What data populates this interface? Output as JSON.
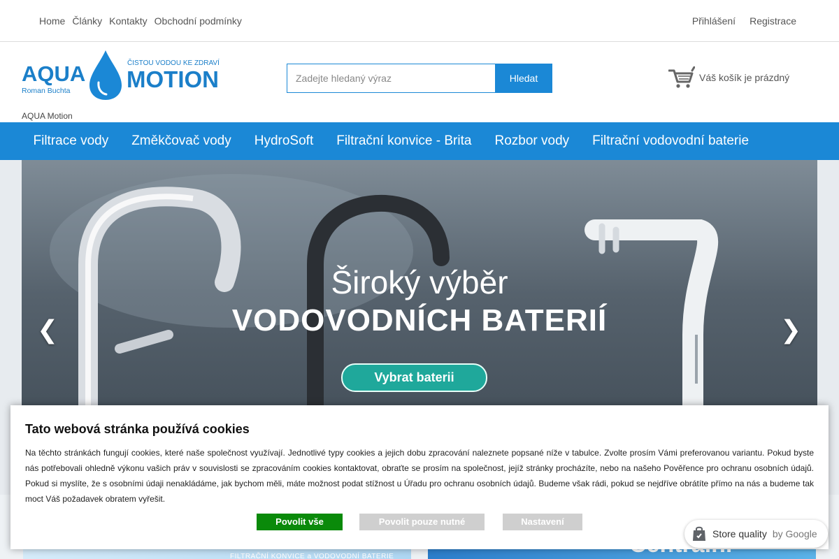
{
  "topnav": {
    "items": [
      "Home",
      "Články",
      "Kontakty",
      "Obchodní podmínky"
    ]
  },
  "account": {
    "login": "Přihlášení",
    "register": "Registrace"
  },
  "logo": {
    "word1": "AQUA",
    "word2": "MOTION",
    "tagline": "ČISTOU VODOU KE ZDRAVÍ",
    "owner": "Roman Buchta",
    "caption": "AQUA Motion"
  },
  "search": {
    "placeholder": "Zadejte hledaný výraz",
    "button": "Hledat"
  },
  "cart": {
    "text": "Váš košík je prázdný"
  },
  "mainnav": {
    "items": [
      "Filtrace vody",
      "Změkčovač vody",
      "HydroSoft",
      "Filtrační konvice - Brita",
      "Rozbor vody",
      "Filtrační vodovodní baterie"
    ]
  },
  "slider": {
    "title1": "Široký výběr",
    "title2": "VODOVODNÍCH BATERIÍ",
    "button": "Vybrat baterii",
    "prev": "❮",
    "next": "❯"
  },
  "promos": {
    "left_text": "FILTRAČNÍ KONVICE a VODOVODNÍ BATERIE",
    "right_text": "Centrální filtrace"
  },
  "cookie": {
    "title": "Tato webová stránka používá cookies",
    "body": "Na těchto stránkách fungují cookies, které naše společnost využívají. Jednotlivé typy cookies a jejich dobu zpracování naleznete popsané níže v tabulce. Zvolte prosím Vámi preferovanou variantu. Pokud byste nás potřebovali ohledně výkonu vašich práv v souvislosti se zpracováním cookies kontaktovat, obraťte se prosím na společnost, jejíž stránky procházíte, nebo na našeho Pověřence pro ochranu osobních údajů. Pokud si myslíte, že s osobními údaji nenakládáme, jak bychom měli, máte možnost podat stížnost u Úřadu pro ochranu osobních údajů. Budeme však rádi, pokud se nejdříve obrátíte přímo na nás a budeme tak moct Váš požadavek obratem vyřešit.",
    "allow_all": "Povolit vše",
    "allow_needed": "Povolit pouze nutné",
    "settings": "Nastavení"
  },
  "badge": {
    "label": "Store quality",
    "by": "by Google"
  },
  "colors": {
    "brand_blue": "#1b88d6",
    "accept_green": "#0a8a0a",
    "slide_button": "#1fa89b"
  }
}
